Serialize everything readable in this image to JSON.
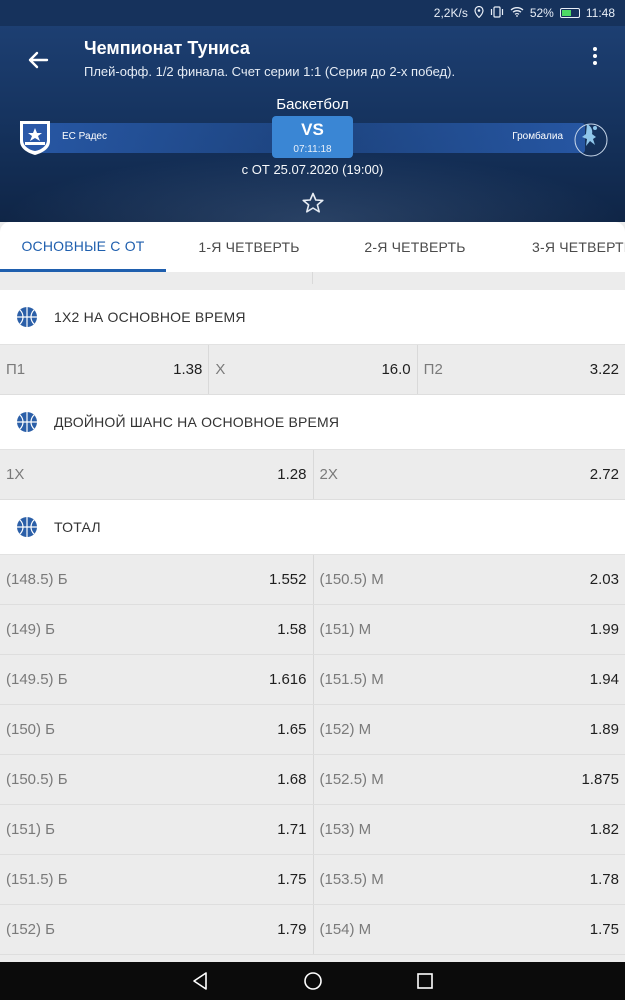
{
  "status_bar": {
    "speed": "2,2K/s",
    "battery": "52%",
    "time": "11:48"
  },
  "header": {
    "title": "Чемпионат Туниса",
    "subtitle": "Плей-офф. 1/2 финала. Счет серии 1:1 (Серия до 2-х побед).",
    "sport": "Баскетбол",
    "team_home": "ЕС Радес",
    "team_away": "Громбалиа",
    "vs": "VS",
    "timer": "07:11:18",
    "datetime": "с ОТ 25.07.2020 (19:00)"
  },
  "tabs": [
    {
      "label": "ОСНОВНЫЕ С ОТ",
      "active": true
    },
    {
      "label": "1-Я ЧЕТВЕРТЬ",
      "active": false
    },
    {
      "label": "2-Я ЧЕТВЕРТЬ",
      "active": false
    },
    {
      "label": "3-Я ЧЕТВЕРТЬ",
      "active": false
    }
  ],
  "sections": {
    "x12": {
      "title": "1X2 НА ОСНОВНОЕ ВРЕМЯ",
      "cells": [
        {
          "name": "П1",
          "odd": "1.38"
        },
        {
          "name": "X",
          "odd": "16.0"
        },
        {
          "name": "П2",
          "odd": "3.22"
        }
      ]
    },
    "double": {
      "title": "ДВОЙНОЙ ШАНС НА ОСНОВНОЕ ВРЕМЯ",
      "cells": [
        {
          "name": "1X",
          "odd": "1.28"
        },
        {
          "name": "2X",
          "odd": "2.72"
        }
      ]
    },
    "total": {
      "title": "ТОТАЛ",
      "rows": [
        [
          {
            "name": "(148.5) Б",
            "odd": "1.552"
          },
          {
            "name": "(150.5) М",
            "odd": "2.03"
          }
        ],
        [
          {
            "name": "(149) Б",
            "odd": "1.58"
          },
          {
            "name": "(151) М",
            "odd": "1.99"
          }
        ],
        [
          {
            "name": "(149.5) Б",
            "odd": "1.616"
          },
          {
            "name": "(151.5) М",
            "odd": "1.94"
          }
        ],
        [
          {
            "name": "(150) Б",
            "odd": "1.65"
          },
          {
            "name": "(152) М",
            "odd": "1.89"
          }
        ],
        [
          {
            "name": "(150.5) Б",
            "odd": "1.68"
          },
          {
            "name": "(152.5) М",
            "odd": "1.875"
          }
        ],
        [
          {
            "name": "(151) Б",
            "odd": "1.71"
          },
          {
            "name": "(153) М",
            "odd": "1.82"
          }
        ],
        [
          {
            "name": "(151.5) Б",
            "odd": "1.75"
          },
          {
            "name": "(153.5) М",
            "odd": "1.78"
          }
        ],
        [
          {
            "name": "(152) Б",
            "odd": "1.79"
          },
          {
            "name": "(154) М",
            "odd": "1.75"
          }
        ]
      ]
    }
  },
  "icons": {
    "back": "arrow-left-icon",
    "menu": "more-vertical-icon",
    "favorite": "star-outline-icon",
    "section": "basketball-icon"
  },
  "colors": {
    "header_bg": "#16325c",
    "accent": "#1f5fae",
    "vs_bg": "#3a86d4"
  }
}
